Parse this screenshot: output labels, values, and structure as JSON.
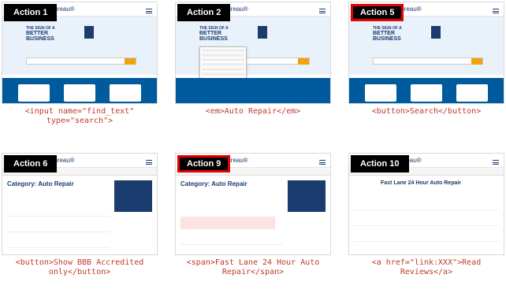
{
  "site": {
    "brand": "Bureau®",
    "hero_line1": "THE SIGN OF A",
    "hero_line2": "BETTER BUSINESS",
    "category_title": "Category: Auto Repair",
    "business_title": "Fast Lane 24 Hour Auto Repair"
  },
  "cells": [
    {
      "action": "Action 1",
      "red": false,
      "caption_parts": [
        "<input name=\"find_text\"",
        "type=\"search\">"
      ]
    },
    {
      "action": "Action 2",
      "red": false,
      "caption_parts": [
        "<em>Auto Repair</em>"
      ]
    },
    {
      "action": "Action 5",
      "red": true,
      "caption_parts": [
        "<button>Search</button>"
      ]
    },
    {
      "action": "Action 6",
      "red": false,
      "caption_parts": [
        "<button>Show BBB Accredited",
        "only</button>"
      ]
    },
    {
      "action": "Action 9",
      "red": true,
      "caption_parts": [
        "<span>Fast Lane 24 Hour Auto",
        "Repair</span>"
      ]
    },
    {
      "action": "Action 10",
      "red": false,
      "caption_parts": [
        "<a href=\"link:XXX\">Read",
        "Reviews</a>"
      ]
    }
  ]
}
